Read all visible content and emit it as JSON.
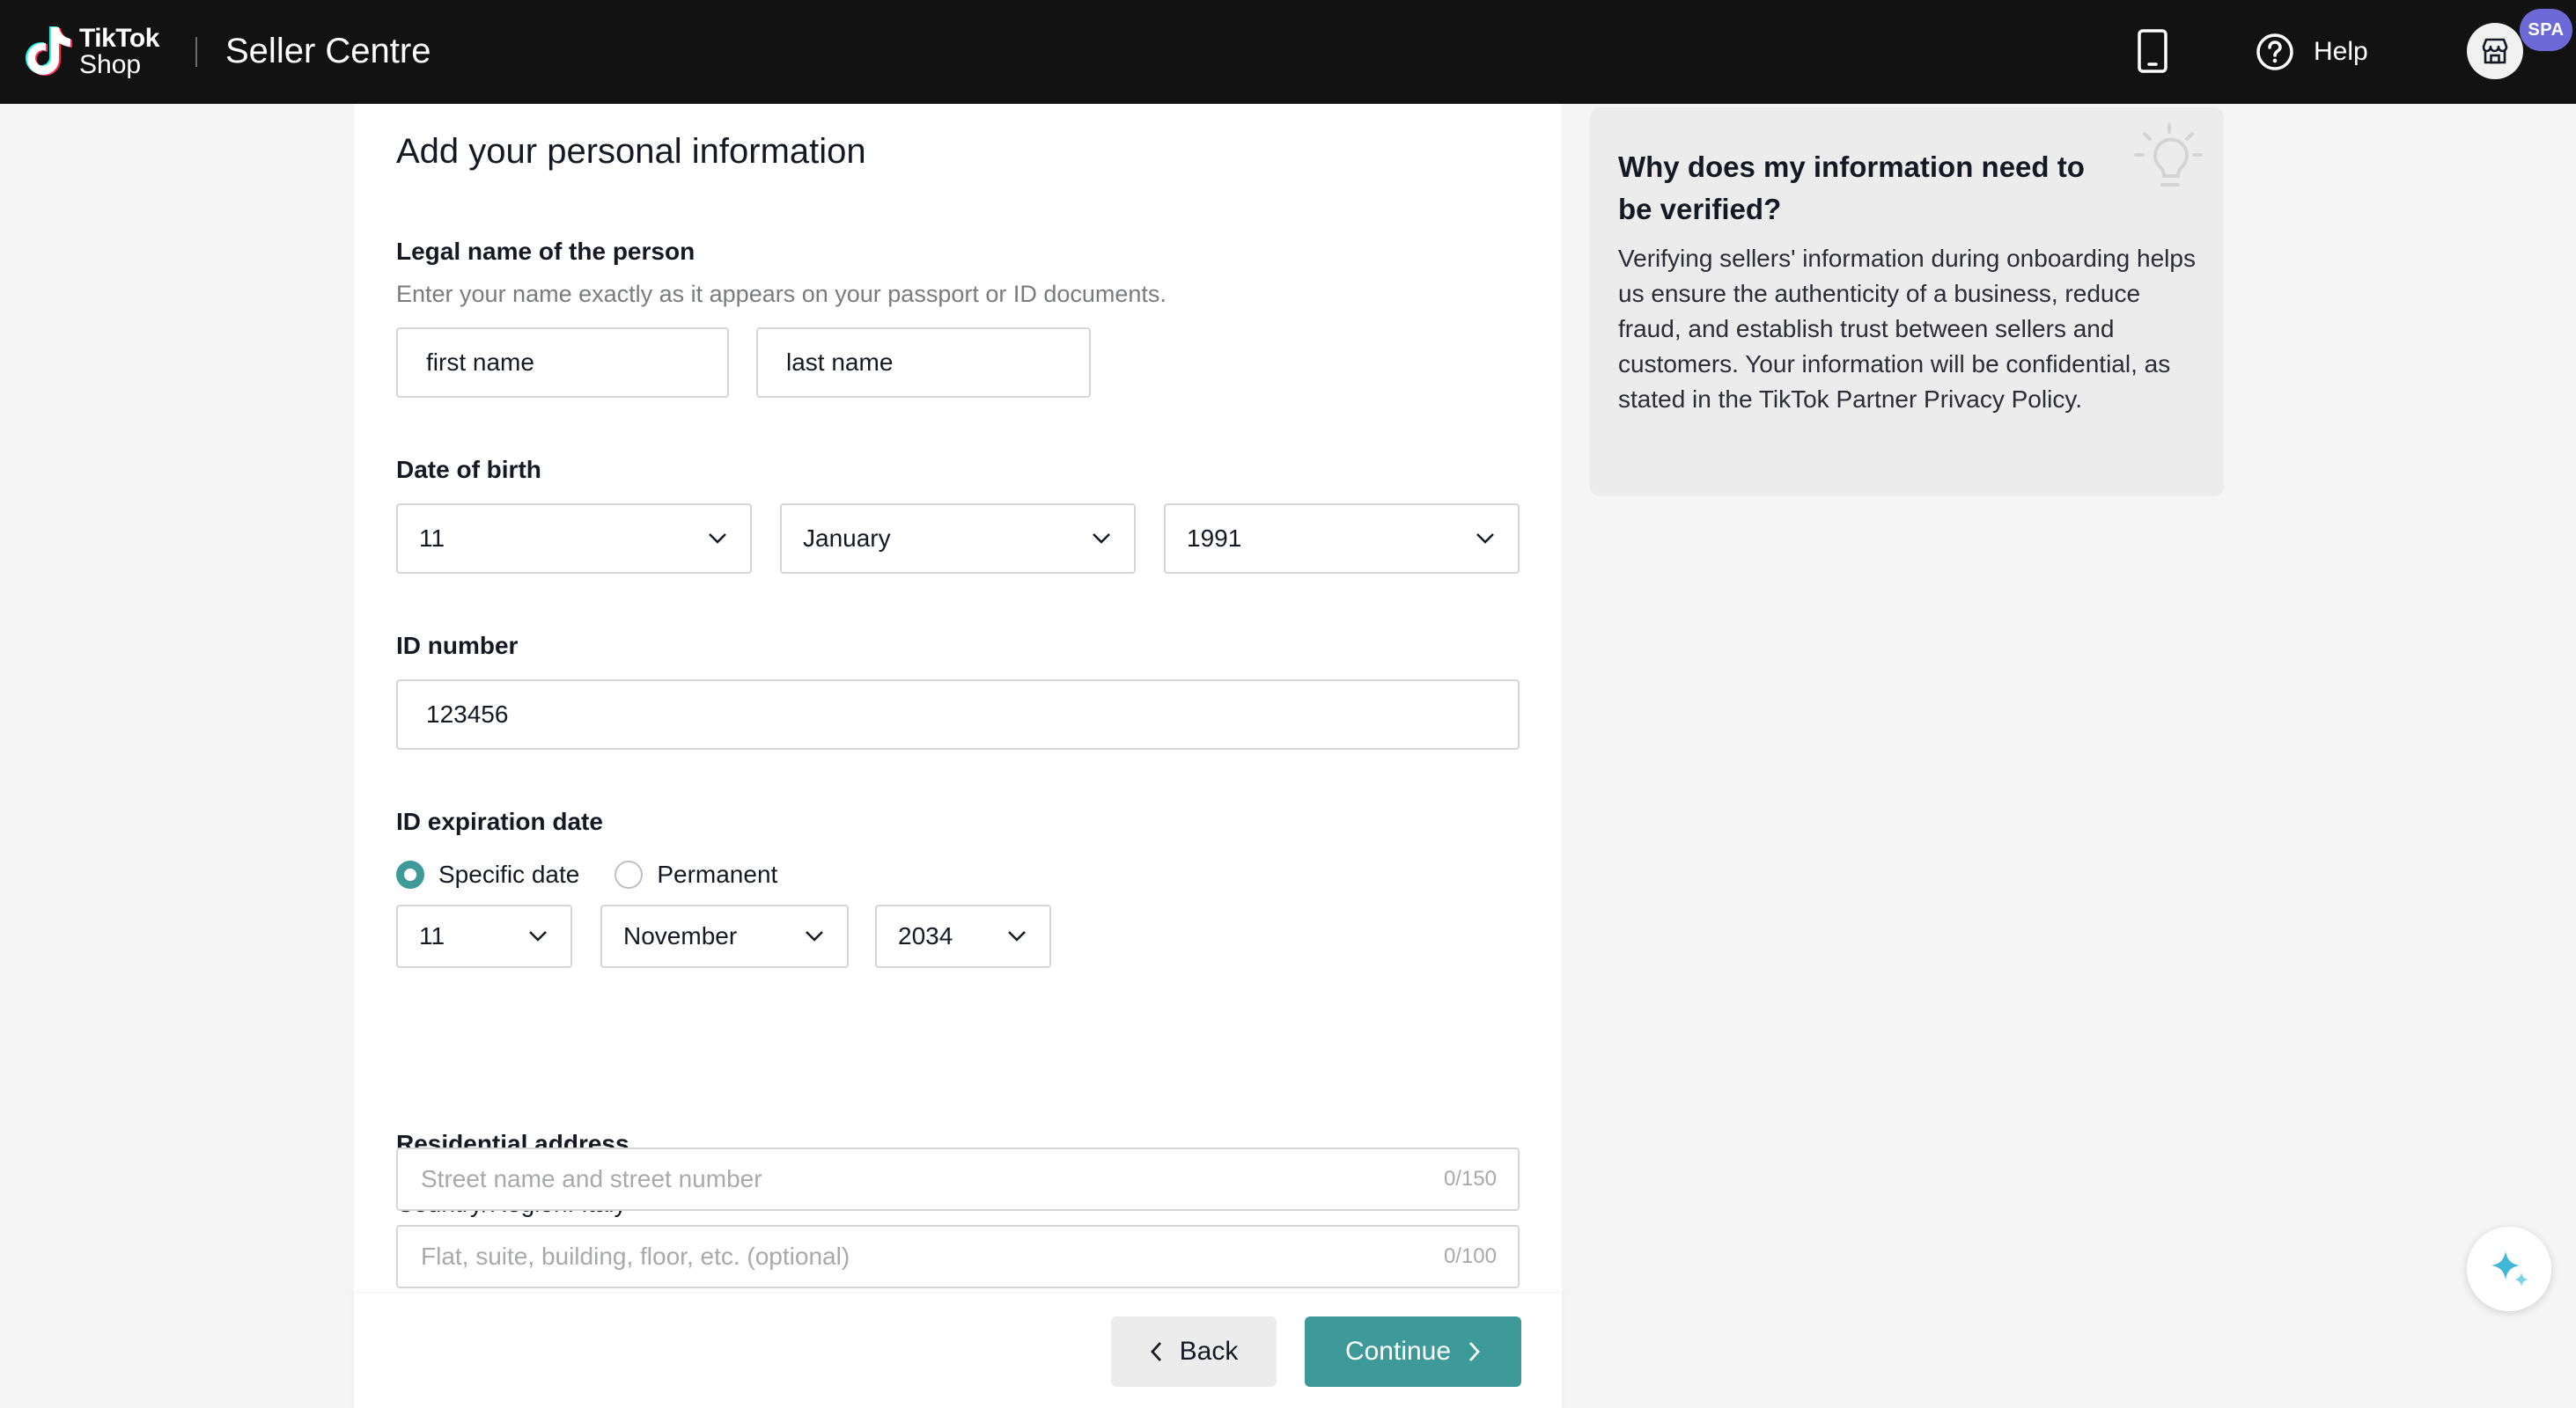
{
  "header": {
    "logo_line1": "TikTok",
    "logo_line2": "Shop",
    "app_title": "Seller Centre",
    "help_label": "Help",
    "badge": "SPA"
  },
  "form": {
    "title": "Add your personal information",
    "legal_name": {
      "label": "Legal name of the person",
      "hint": "Enter your name exactly as it appears on your passport or ID documents.",
      "first_name": "first name",
      "last_name": "last name"
    },
    "dob": {
      "label": "Date of birth",
      "day": "11",
      "month": "January",
      "year": "1991"
    },
    "id_number": {
      "label": "ID number",
      "value": "123456"
    },
    "id_expiration": {
      "label": "ID expiration date",
      "option_specific": "Specific date",
      "option_permanent": "Permanent",
      "selected": "specific",
      "day": "11",
      "month": "November",
      "year": "2034"
    },
    "address": {
      "label": "Residential address",
      "country": "Country/Region: Italy",
      "street_placeholder": "Street name and street number",
      "street_counter": "0/150",
      "flat_placeholder": "Flat, suite, building, floor, etc. (optional)",
      "flat_counter": "0/100"
    },
    "back_label": "Back",
    "continue_label": "Continue"
  },
  "info": {
    "title": "Why does my information need to be verified?",
    "body": "Verifying sellers' information during onboarding helps us ensure the authenticity of a business, reduce fraud, and establish trust between sellers and customers. Your information will be confidential, as stated in the TikTok Partner Privacy Policy."
  },
  "colors": {
    "accent": "#3e9a98",
    "topbar": "#121212",
    "badge": "#6d6ad8"
  },
  "icons": [
    "tiktok-logo-icon",
    "mobile-phone-icon",
    "help-circle-icon",
    "store-icon",
    "chevron-down-icon",
    "chevron-left-icon",
    "chevron-right-icon",
    "lightbulb-icon",
    "sparkle-icon"
  ]
}
